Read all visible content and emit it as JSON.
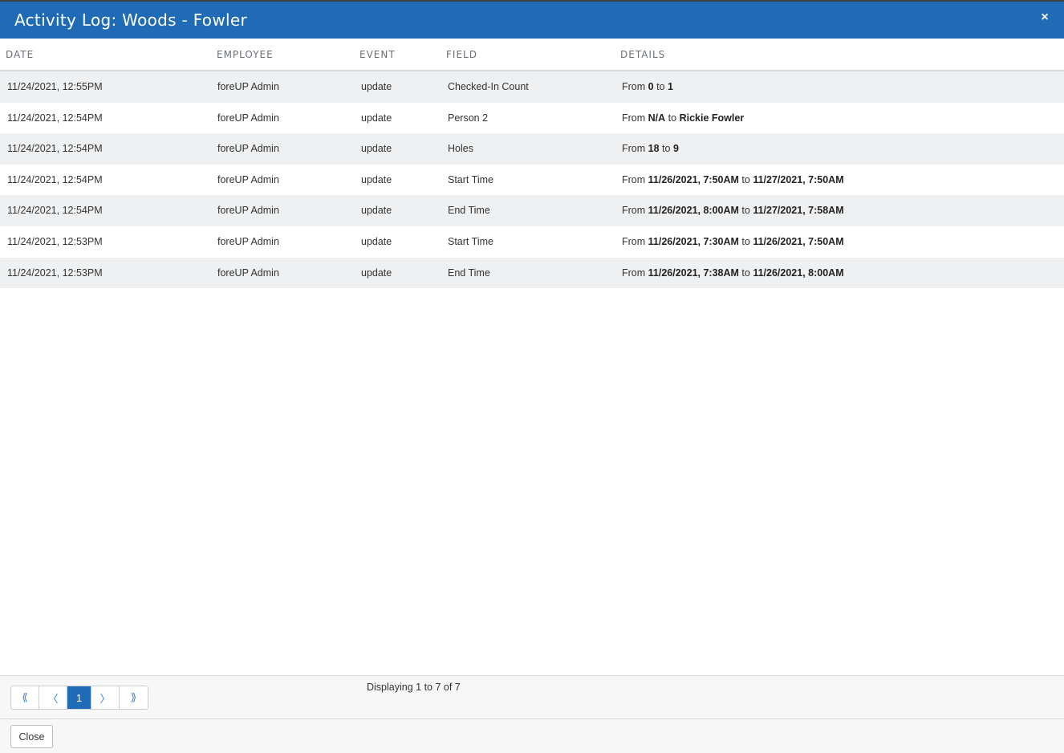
{
  "dialog": {
    "title": "Activity Log: Woods - Fowler",
    "close_icon": "×"
  },
  "table": {
    "headers": [
      "DATE",
      "EMPLOYEE",
      "EVENT",
      "FIELD",
      "DETAILS"
    ],
    "rows": [
      {
        "date": "11/24/2021, 12:55PM",
        "employee": "foreUP Admin",
        "event": "update",
        "field": "Checked-In Count",
        "from_label": "From",
        "from": "0",
        "to_label": "to",
        "to": "1"
      },
      {
        "date": "11/24/2021, 12:54PM",
        "employee": "foreUP Admin",
        "event": "update",
        "field": "Person 2",
        "from_label": "From",
        "from": "N/A",
        "to_label": "to",
        "to": "Rickie Fowler"
      },
      {
        "date": "11/24/2021, 12:54PM",
        "employee": "foreUP Admin",
        "event": "update",
        "field": "Holes",
        "from_label": "From",
        "from": "18",
        "to_label": "to",
        "to": "9"
      },
      {
        "date": "11/24/2021, 12:54PM",
        "employee": "foreUP Admin",
        "event": "update",
        "field": "Start Time",
        "from_label": "From",
        "from": "11/26/2021, 7:50AM",
        "to_label": "to",
        "to": "11/27/2021, 7:50AM"
      },
      {
        "date": "11/24/2021, 12:54PM",
        "employee": "foreUP Admin",
        "event": "update",
        "field": "End Time",
        "from_label": "From",
        "from": "11/26/2021, 8:00AM",
        "to_label": "to",
        "to": "11/27/2021, 7:58AM"
      },
      {
        "date": "11/24/2021, 12:53PM",
        "employee": "foreUP Admin",
        "event": "update",
        "field": "Start Time",
        "from_label": "From",
        "from": "11/26/2021, 7:30AM",
        "to_label": "to",
        "to": "11/26/2021, 7:50AM"
      },
      {
        "date": "11/24/2021, 12:53PM",
        "employee": "foreUP Admin",
        "event": "update",
        "field": "End Time",
        "from_label": "From",
        "from": "11/26/2021, 7:38AM",
        "to_label": "to",
        "to": "11/26/2021, 8:00AM"
      }
    ]
  },
  "pagination": {
    "first": "⟪",
    "prev": "〈",
    "current": "1",
    "next": "〉",
    "last": "⟫",
    "displaying": "Displaying 1 to 7 of 7"
  },
  "actions": {
    "close_label": "Close"
  },
  "colors": {
    "header_blue": "#1f6bb6",
    "row_alt": "#eef0f2"
  }
}
